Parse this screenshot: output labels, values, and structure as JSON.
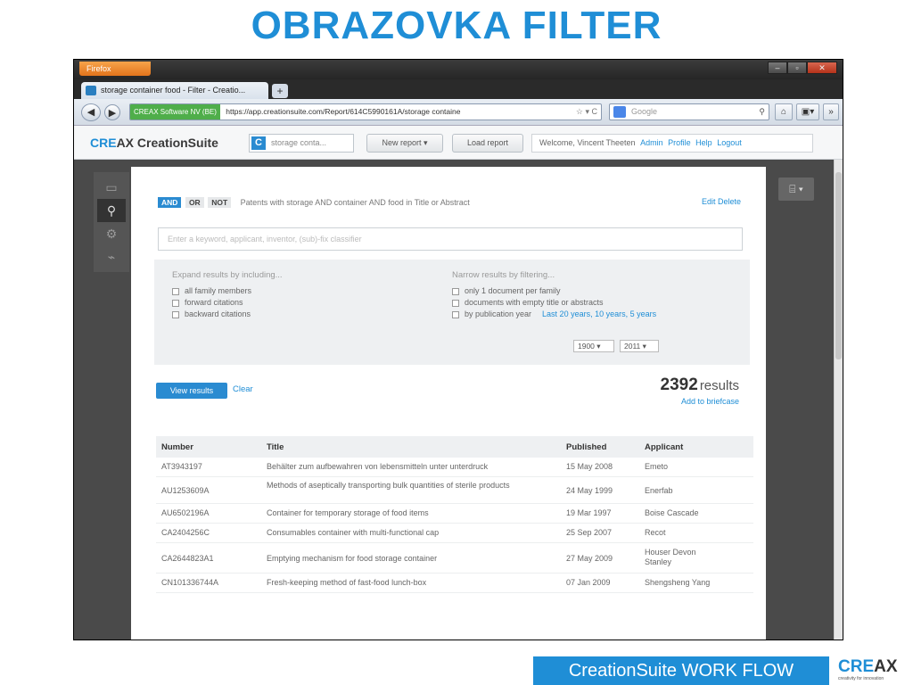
{
  "slide": {
    "title": "OBRAZOVKA FILTER",
    "footer_bar": "CreationSuite WORK FLOW",
    "footer_logo": {
      "cre": "CRE",
      "ax": "AX",
      "tagline": "creativity for innovation"
    },
    "colors": {
      "accent": "#1f8ed6"
    }
  },
  "browser": {
    "menu_button": "Firefox",
    "tab_title": "storage container food - Filter - Creatio...",
    "new_tab": "+",
    "identity": "CREAX Software NV (BE)",
    "url": "https://app.creationsuite.com/Report/614C5990161A/storage containe",
    "search_placeholder": "Google"
  },
  "app": {
    "logo_cre": "CRE",
    "logo_rest": "AX CreationSuite",
    "report_tab": "storage conta...",
    "new_report": "New report",
    "load_report": "Load report",
    "welcome": "Welcome, Vincent Theeten",
    "links": {
      "admin": "Admin",
      "profile": "Profile",
      "help": "Help",
      "logout": "Logout"
    }
  },
  "filter": {
    "ops": {
      "and": "AND",
      "or": "OR",
      "not": "NOT"
    },
    "query": "Patents with storage AND container AND food in Title or Abstract",
    "edit": "Edit",
    "delete": "Delete",
    "search_placeholder": "Enter a keyword, applicant, inventor, (sub)-fix classifier",
    "expand": {
      "heading": "Expand results by including...",
      "items": [
        "all family members",
        "forward citations",
        "backward citations"
      ]
    },
    "narrow": {
      "heading": "Narrow results by filtering...",
      "items": [
        "only 1 document per family",
        "documents with empty title or abstracts",
        "by publication year"
      ],
      "year_links": "Last 20 years, 10 years, 5 years",
      "from_year": "1900",
      "to_year": "2011"
    }
  },
  "results": {
    "view_button": "View results",
    "clear": "Clear",
    "count": "2392",
    "count_label": "results",
    "add_briefcase": "Add to briefcase"
  },
  "table": {
    "headers": [
      "Number",
      "Title",
      "Published",
      "Applicant"
    ],
    "rows": [
      [
        "AT3943197",
        "Behälter zum aufbewahren von lebensmitteln unter unterdruck",
        "15 May 2008",
        "Emeto"
      ],
      [
        "AU1253609A",
        "Methods of aseptically transporting bulk quantities of sterile products",
        "24 May 1999",
        "Enerfab"
      ],
      [
        "AU6502196A",
        "Container for temporary storage of food items",
        "19 Mar 1997",
        "Boise Cascade"
      ],
      [
        "CA2404256C",
        "Consumables container with multi-functional cap",
        "25 Sep 2007",
        "Recot"
      ],
      [
        "CA2644823A1",
        "Emptying mechanism for food storage container",
        "27 May 2009",
        "Houser Devon Stanley"
      ],
      [
        "CN101336744A",
        "Fresh-keeping method of fast-food lunch-box",
        "07 Jan 2009",
        "Shengsheng Yang"
      ]
    ]
  }
}
